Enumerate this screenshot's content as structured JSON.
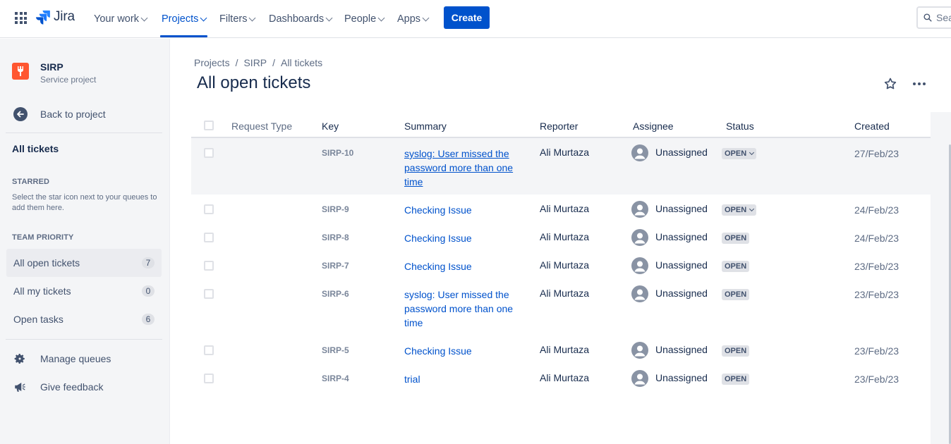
{
  "topnav": {
    "logo_text": "Jira",
    "items": [
      {
        "label": "Your work",
        "active": false
      },
      {
        "label": "Projects",
        "active": true
      },
      {
        "label": "Filters",
        "active": false
      },
      {
        "label": "Dashboards",
        "active": false
      },
      {
        "label": "People",
        "active": false
      },
      {
        "label": "Apps",
        "active": false
      }
    ],
    "create_label": "Create",
    "search_placeholder": "Search",
    "accent_color": "#0052CC"
  },
  "sidebar": {
    "project_name": "SIRP",
    "project_type": "Service project",
    "back_label": "Back to project",
    "all_tickets_label": "All tickets",
    "starred_heading": "STARRED",
    "starred_help": "Select the star icon next to your queues to add them here.",
    "team_priority_heading": "TEAM PRIORITY",
    "queues": [
      {
        "label": "All open tickets",
        "count": "7",
        "active": true
      },
      {
        "label": "All my tickets",
        "count": "0",
        "active": false
      },
      {
        "label": "Open tasks",
        "count": "6",
        "active": false
      }
    ],
    "manage_queues_label": "Manage queues",
    "give_feedback_label": "Give feedback"
  },
  "main": {
    "breadcrumb": [
      "Projects",
      "SIRP",
      "All tickets"
    ],
    "title": "All open tickets",
    "columns": [
      "Request Type",
      "Key",
      "Summary",
      "Reporter",
      "Assignee",
      "Status",
      "Created"
    ],
    "rows": [
      {
        "key": "SIRP-10",
        "summary": "syslog: User missed the password more than one time",
        "reporter": "Ali Murtaza",
        "assignee": "Unassigned",
        "status": "OPEN",
        "status_dropdown": true,
        "created": "27/Feb/23",
        "highlighted": true,
        "underlined": true
      },
      {
        "key": "SIRP-9",
        "summary": "Checking Issue",
        "reporter": "Ali Murtaza",
        "assignee": "Unassigned",
        "status": "OPEN",
        "status_dropdown": true,
        "created": "24/Feb/23",
        "highlighted": false,
        "underlined": false
      },
      {
        "key": "SIRP-8",
        "summary": "Checking Issue",
        "reporter": "Ali Murtaza",
        "assignee": "Unassigned",
        "status": "OPEN",
        "status_dropdown": false,
        "created": "24/Feb/23",
        "highlighted": false,
        "underlined": false
      },
      {
        "key": "SIRP-7",
        "summary": "Checking Issue",
        "reporter": "Ali Murtaza",
        "assignee": "Unassigned",
        "status": "OPEN",
        "status_dropdown": false,
        "created": "23/Feb/23",
        "highlighted": false,
        "underlined": false
      },
      {
        "key": "SIRP-6",
        "summary": "syslog: User missed the password more than one time",
        "reporter": "Ali Murtaza",
        "assignee": "Unassigned",
        "status": "OPEN",
        "status_dropdown": false,
        "created": "23/Feb/23",
        "highlighted": false,
        "underlined": false
      },
      {
        "key": "SIRP-5",
        "summary": "Checking Issue",
        "reporter": "Ali Murtaza",
        "assignee": "Unassigned",
        "status": "OPEN",
        "status_dropdown": false,
        "created": "23/Feb/23",
        "highlighted": false,
        "underlined": false
      },
      {
        "key": "SIRP-4",
        "summary": "trial",
        "reporter": "Ali Murtaza",
        "assignee": "Unassigned",
        "status": "OPEN",
        "status_dropdown": false,
        "created": "23/Feb/23",
        "highlighted": false,
        "underlined": false
      }
    ]
  }
}
